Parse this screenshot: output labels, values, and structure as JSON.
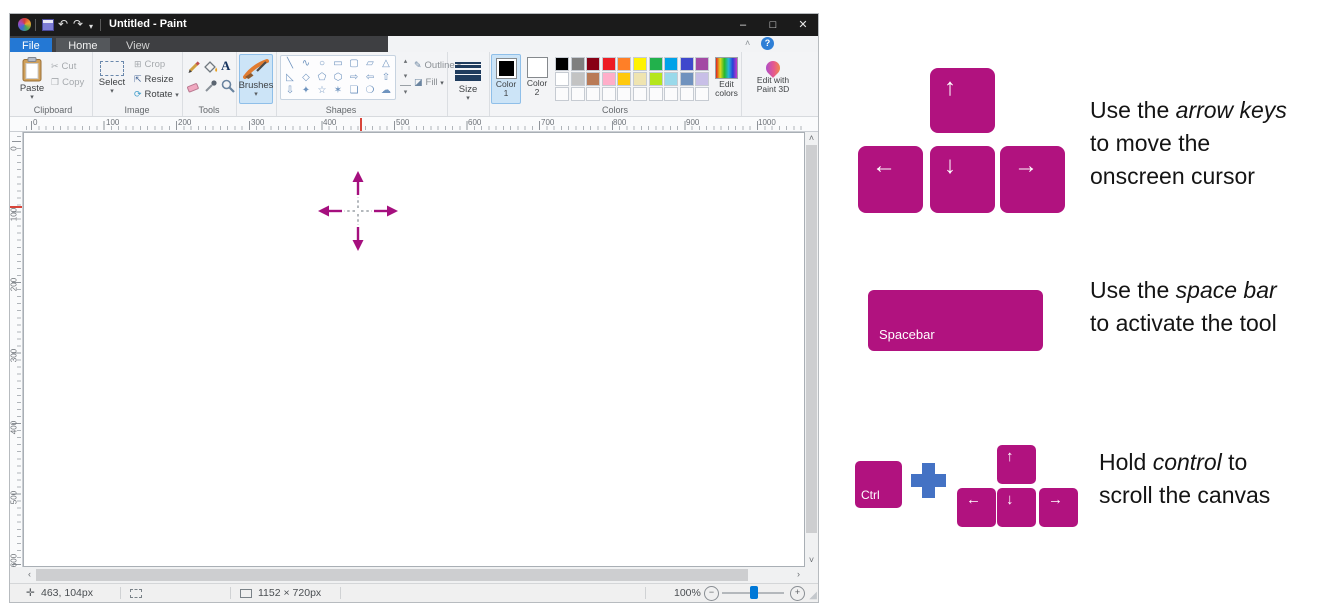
{
  "window": {
    "title": "Untitled - Paint",
    "tabs": {
      "file": "File",
      "home": "Home",
      "view": "View"
    },
    "controls": {
      "minimize": "–",
      "maximize": "□",
      "close": "✕"
    },
    "quick_access": {
      "undo": "↶",
      "redo": "↷",
      "dropdown": "▾"
    }
  },
  "ribbon": {
    "collapse": "˄",
    "help": "?",
    "clipboard": {
      "section": "Clipboard",
      "paste": "Paste",
      "cut": "Cut",
      "copy": "Copy",
      "cut_icon": "✂",
      "copy_icon": "❐",
      "dropdown": "▾"
    },
    "image": {
      "section": "Image",
      "select": "Select",
      "crop": "Crop",
      "resize": "Resize",
      "rotate": "Rotate",
      "crop_icon": "⊞",
      "resize_icon": "⇱",
      "rotate_icon": "⟳",
      "dropdown": "▾"
    },
    "tools": {
      "section": "Tools",
      "text_tool": "A",
      "icons": [
        "pencil-icon",
        "fill-icon",
        "text-icon",
        "eraser-icon",
        "eyedropper-icon",
        "magnifier-icon"
      ]
    },
    "brushes": {
      "label": "Brushes",
      "dropdown": "▾"
    },
    "shapes": {
      "section": "Shapes",
      "outline": "Outline",
      "fill": "Fill",
      "outline_icon": "✎",
      "fill_icon": "◪",
      "scroll_up": "▴",
      "scroll_down": "▾",
      "dropdown": "▾",
      "glyphs": [
        "╲",
        "∿",
        "○",
        "▭",
        "▢",
        "▱",
        "△",
        "◺",
        "◇",
        "⬠",
        "⬡",
        "⇨",
        "⇦",
        "⇧",
        "⇩",
        "✦",
        "☆",
        "✶",
        "❏",
        "❍",
        "☁"
      ]
    },
    "size": {
      "label": "Size",
      "dropdown": "▾"
    },
    "colors": {
      "section": "Colors",
      "color1_top": "Color",
      "color1_bottom": "1",
      "color2_top": "Color",
      "color2_bottom": "2",
      "edit_top": "Edit",
      "edit_bottom": "colors",
      "p3d_top": "Edit with",
      "p3d_bottom": "Paint 3D",
      "color1_value": "#000000",
      "color2_value": "#ffffff",
      "row1": [
        "#000000",
        "#7f7f7f",
        "#880015",
        "#ed1c24",
        "#ff7f27",
        "#fff200",
        "#22b14c",
        "#00a2e8",
        "#3f48cc",
        "#a349a4"
      ],
      "row2": [
        "#ffffff",
        "#c3c3c3",
        "#b97a57",
        "#ffaec9",
        "#ffc90e",
        "#efe4b0",
        "#b5e61d",
        "#99d9ea",
        "#7092be",
        "#c8bfe7"
      ],
      "row3": [
        "",
        "",
        "",
        "",
        "",
        "",
        "",
        "",
        "",
        ""
      ]
    }
  },
  "rulers": {
    "horizontal": [
      "0",
      "100",
      "200",
      "300",
      "400",
      "500",
      "600",
      "700",
      "800",
      "900",
      "1000"
    ],
    "vertical": [
      "0",
      "100",
      "200",
      "300",
      "400",
      "500",
      "600"
    ]
  },
  "scrollbars": {
    "up": "˄",
    "down": "˅",
    "left": "‹",
    "right": "›"
  },
  "status": {
    "cursor_icon": "✛",
    "cursor": "463, 104px",
    "size": "1152 × 720px",
    "zoom": "100%",
    "minus": "−",
    "plus": "+",
    "grip": "◢"
  },
  "guide": {
    "key_color": "#b1127f",
    "plus_color": "#4472c4",
    "up": "↑",
    "down": "↓",
    "left": "←",
    "right": "→",
    "spacebar": "Spacebar",
    "ctrl": "Ctrl",
    "i1": {
      "l1a": "Use the ",
      "l1em": "arrow keys",
      "l2": "to move the",
      "l3": "onscreen cursor"
    },
    "i2": {
      "l1a": "Use the ",
      "l1em": "space bar",
      "l2": "to activate the tool"
    },
    "i3": {
      "l1a": "Hold ",
      "l1em": "control",
      "l1b": " to",
      "l2": "scroll the canvas"
    }
  }
}
